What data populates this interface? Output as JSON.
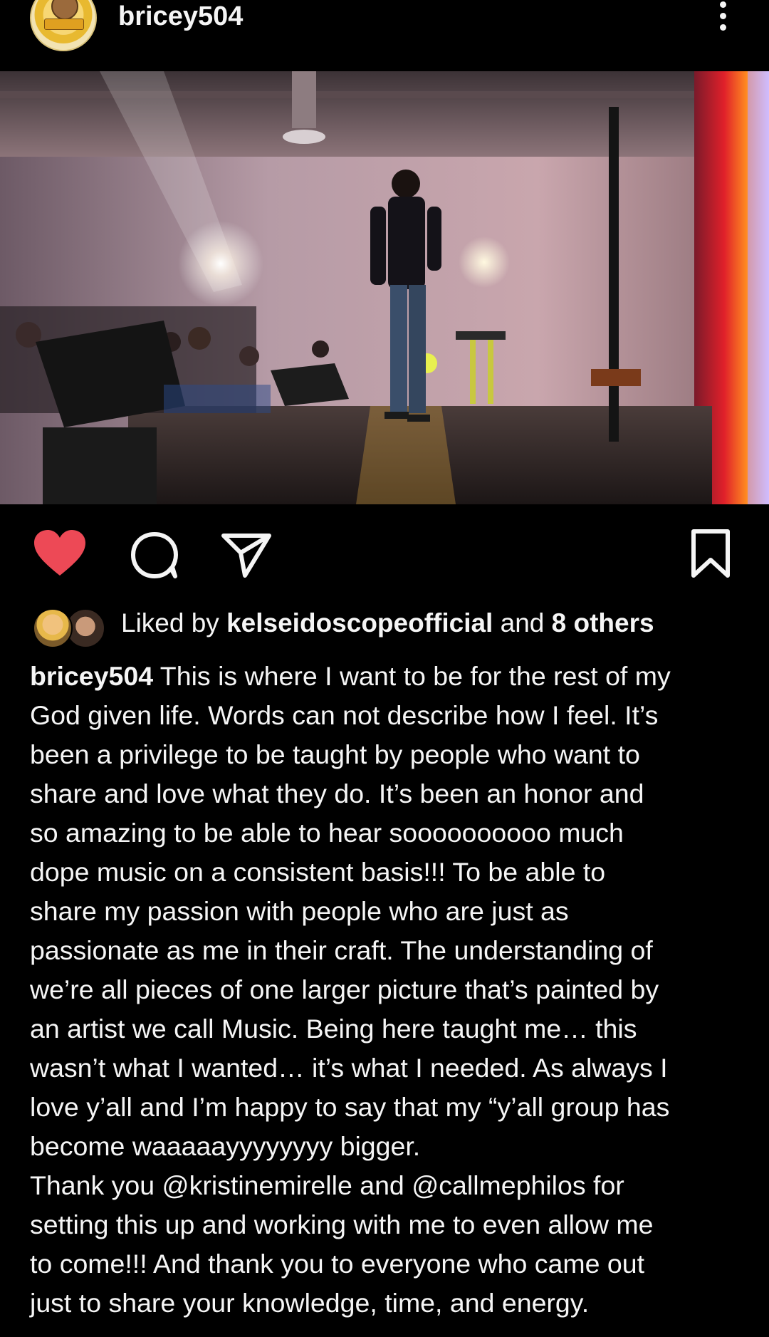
{
  "post": {
    "username": "bricey504",
    "avatar_label": "BRICEY"
  },
  "icons": {
    "more": "more-vertical-icon",
    "like": "heart-icon",
    "comment": "comment-icon",
    "share": "send-icon",
    "save": "bookmark-icon"
  },
  "colors": {
    "background": "#000000",
    "text": "#f5f5f5",
    "liked_heart": "#ed4956"
  },
  "likes": {
    "prefix": "Liked by ",
    "user": "kelseidoscopeofficial",
    "middle": " and ",
    "others": "8 others"
  },
  "caption": {
    "author": "bricey504",
    "lines": [
      " This is where I want to be for the rest of my",
      "God given life. Words can not describe how I feel. It’s",
      "been a privilege to be taught by people who want to",
      "share and love what they do. It’s been an honor and",
      "so amazing to be able to hear soooooooooo much",
      "dope music on a consistent basis!!! To be able to",
      "share my passion with people who are just as",
      "passionate as me in their craft. The understanding of",
      "we’re all pieces of one larger picture that’s painted by",
      "an artist we call Music. Being here taught me… this",
      "wasn’t what I wanted… it’s what I needed. As always I",
      "love y’all and I’m happy to say that my “y’all group has",
      "become waaaaayyyyyyyy bigger.",
      "Thank you @kristinemirelle and @callmephilos for",
      "setting this up and working with me to even allow me",
      "to come!!! And thank you to everyone who came out",
      "just to share your knowledge, time, and energy."
    ]
  }
}
